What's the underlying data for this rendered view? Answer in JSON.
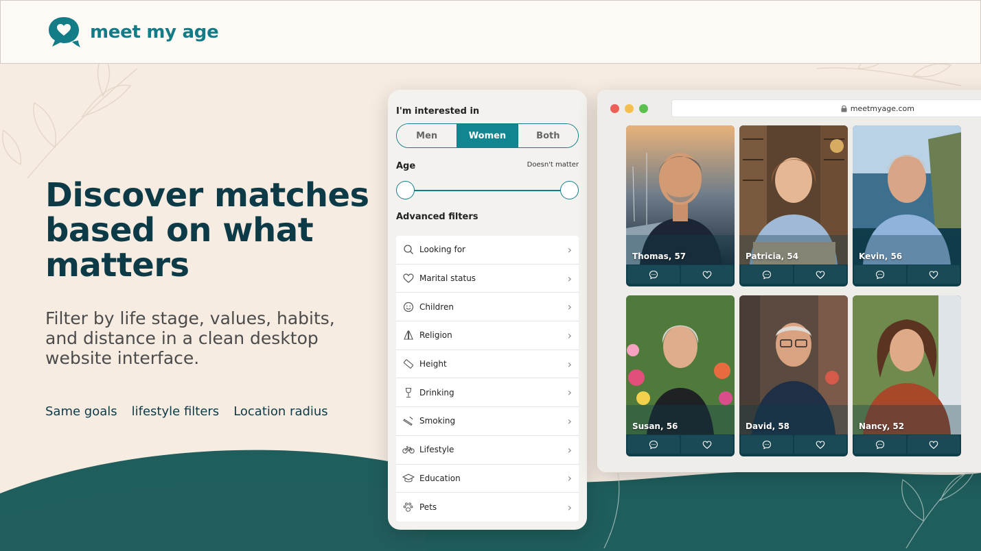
{
  "brand": {
    "name": "meet my age",
    "color": "#137c86"
  },
  "hero": {
    "title": "Discover matches based on what matters",
    "subtitle": "Filter by life stage, values, habits, and distance in a clean desktop website interface.",
    "tags": [
      "Same goals",
      "lifestyle filters",
      "Location radius"
    ]
  },
  "filters": {
    "interest_label": "I'm interested in",
    "interest_options": [
      "Men",
      "Women",
      "Both"
    ],
    "interest_selected": "Women",
    "age_label": "Age",
    "age_note": "Doesn't matter",
    "advanced_label": "Advanced filters",
    "items": [
      {
        "label": "Looking for",
        "icon": "search-icon"
      },
      {
        "label": "Marital status",
        "icon": "heart-icon"
      },
      {
        "label": "Children",
        "icon": "smiley-icon"
      },
      {
        "label": "Religion",
        "icon": "praying-hands-icon"
      },
      {
        "label": "Height",
        "icon": "ruler-icon"
      },
      {
        "label": "Drinking",
        "icon": "wine-glass-icon"
      },
      {
        "label": "Smoking",
        "icon": "cigarette-icon"
      },
      {
        "label": "Lifestyle",
        "icon": "bicycle-icon"
      },
      {
        "label": "Education",
        "icon": "graduation-cap-icon"
      },
      {
        "label": "Pets",
        "icon": "paw-icon"
      }
    ]
  },
  "browser": {
    "url": "meetmyage.com",
    "profiles": [
      {
        "name": "Thomas, 57"
      },
      {
        "name": "Patricia, 54"
      },
      {
        "name": "Kevin, 56"
      },
      {
        "name": "Susan, 56"
      },
      {
        "name": "David, 58"
      },
      {
        "name": "Nancy, 52"
      }
    ]
  },
  "colors": {
    "teal": "#128690",
    "dark_teal": "#1f5e5c",
    "background": "#f6ece2"
  }
}
